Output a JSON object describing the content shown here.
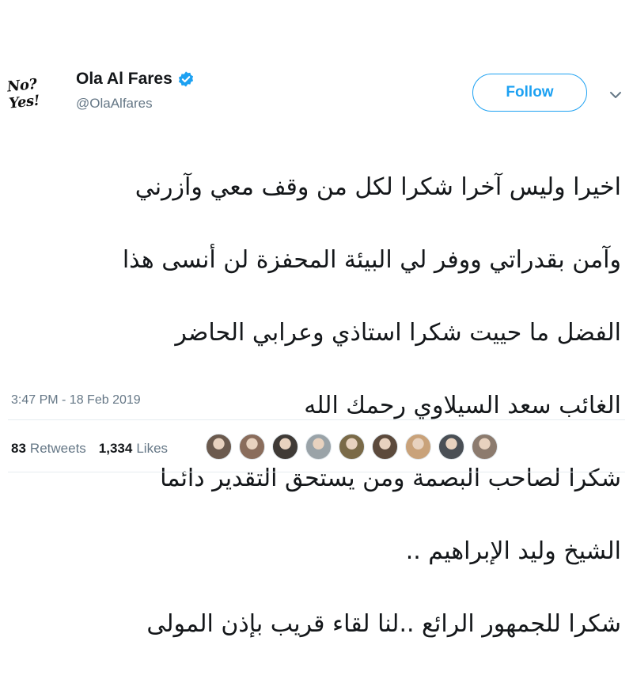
{
  "author": {
    "avatar_text": "No? Yes!",
    "display_name": "Ola Al Fares",
    "handle": "@OlaAlfares",
    "verified": true
  },
  "follow_label": "Follow",
  "tweet": {
    "lines": [
      "اخيرا وليس آخرا  شكرا لكل من وقف معي وآزرني",
      "وآمن بقدراتي ووفر لي البيئة المحفزة لن أنسى هذا",
      "الفضل ما حييت شكرا استاذي وعرابي الحاضر",
      "الغائب سعد السيلاوي رحمك الله",
      "شكرا لصاحب البصمة ومن يستحق التقدير دائما",
      "الشيخ وليد الإبراهيم ..",
      "شكرا للجمهور الرائع ..لنا لقاء قريب بإذن المولى"
    ],
    "timestamp": "3:47 PM - 18 Feb 2019"
  },
  "stats": {
    "retweets_count": "83",
    "retweets_label": "Retweets",
    "likes_count": "1,334",
    "likes_label": "Likes"
  },
  "likers": [
    {
      "icon": "user-avatar",
      "color": "#6b5a4e"
    },
    {
      "icon": "user-avatar",
      "color": "#8a6d5c"
    },
    {
      "icon": "user-avatar",
      "color": "#3f3a36"
    },
    {
      "icon": "user-avatar",
      "color": "#9aa3a8"
    },
    {
      "icon": "user-avatar",
      "color": "#7a6a48"
    },
    {
      "icon": "user-avatar",
      "color": "#5c4a3c"
    },
    {
      "icon": "user-avatar",
      "color": "#c9a27a"
    },
    {
      "icon": "user-avatar",
      "color": "#4a4f55"
    },
    {
      "icon": "user-avatar",
      "color": "#8c7b6e"
    }
  ],
  "colors": {
    "accent": "#1da1f2",
    "secondary_text": "#657786",
    "divider": "#e6ecf0"
  }
}
